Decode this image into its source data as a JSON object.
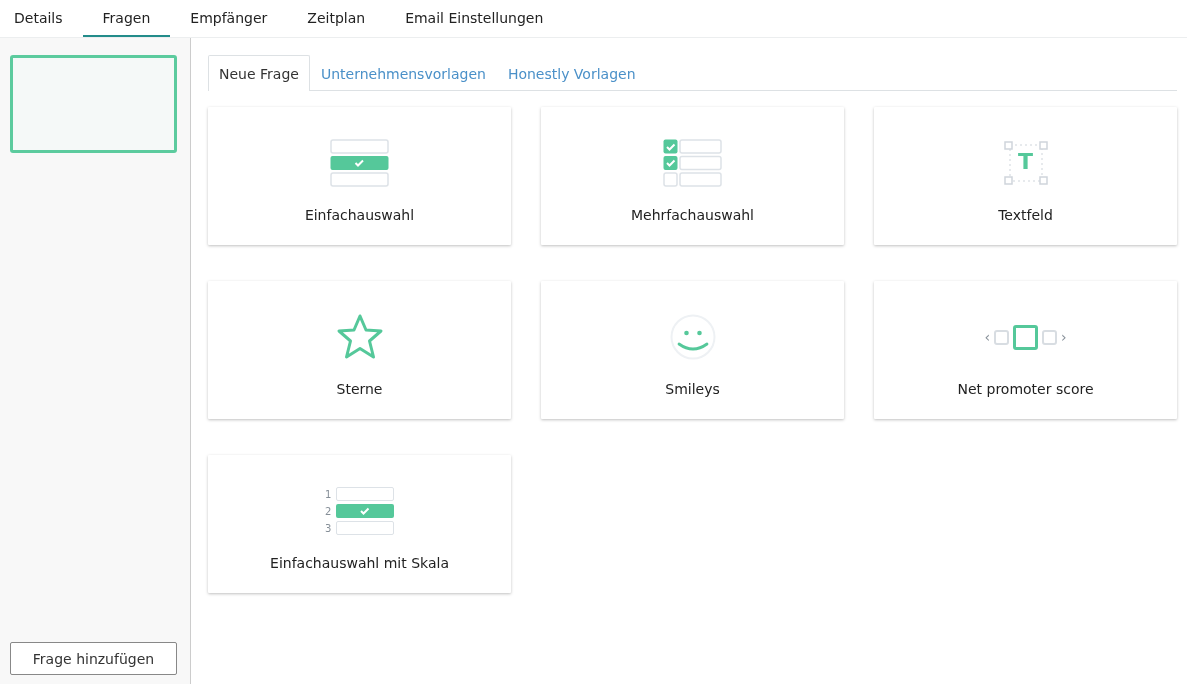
{
  "tabs": [
    {
      "label": "Details",
      "selected": false
    },
    {
      "label": "Fragen",
      "selected": true
    },
    {
      "label": "Empfänger",
      "selected": false
    },
    {
      "label": "Zeitplan",
      "selected": false
    },
    {
      "label": "Email Einstellungen",
      "selected": false
    }
  ],
  "sidebar": {
    "questions": [
      {
        "selected": true
      }
    ],
    "add_button": "Frage hinzufügen"
  },
  "subtabs": [
    {
      "label": "Neue Frage",
      "selected": true
    },
    {
      "label": "Unternehmensvorlagen",
      "selected": false
    },
    {
      "label": "Honestly Vorlagen",
      "selected": false
    }
  ],
  "question_types": [
    {
      "kind": "single",
      "label": "Einfachauswahl"
    },
    {
      "kind": "multi",
      "label": "Mehrfachauswahl"
    },
    {
      "kind": "text",
      "label": "Textfeld",
      "icon_text": "T"
    },
    {
      "kind": "stars",
      "label": "Sterne"
    },
    {
      "kind": "smiley",
      "label": "Smileys"
    },
    {
      "kind": "nps",
      "label": "Net promoter score",
      "icon_text": [
        "‹",
        "›"
      ]
    },
    {
      "kind": "scale",
      "label": "Einfachauswahl mit Skala",
      "icon_text": [
        "1",
        "2",
        "3"
      ]
    }
  ]
}
